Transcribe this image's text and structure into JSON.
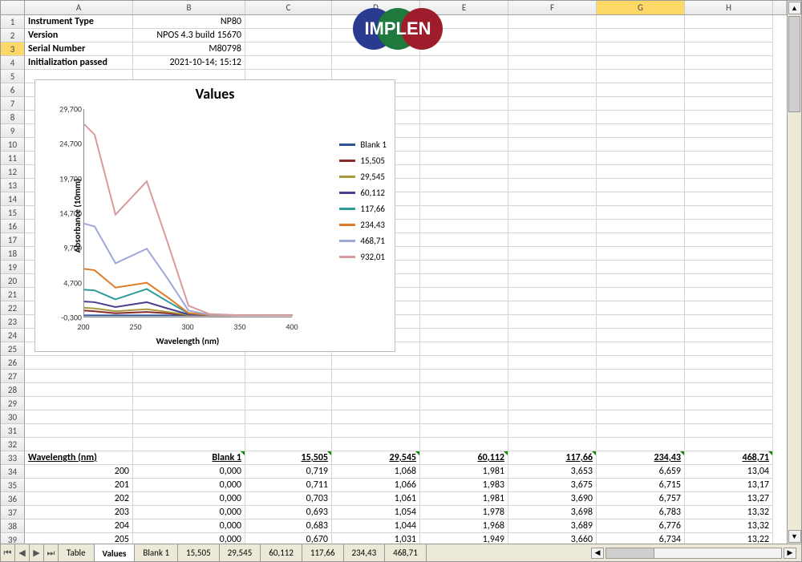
{
  "columns": [
    "A",
    "B",
    "C",
    "D",
    "E",
    "F",
    "G",
    "H"
  ],
  "active_column": "G",
  "row_start": 1,
  "row_end": 39,
  "active_row": 3,
  "info_rows": [
    {
      "label": "Instrument Type",
      "value": "NP80"
    },
    {
      "label": "Version",
      "value": "NPOS 4.3 build 15670"
    },
    {
      "label": "Serial Number",
      "value": "M80798"
    },
    {
      "label": "Initialization passed",
      "value": "2021-10-14;  15:12"
    }
  ],
  "logo_text": "IMPLEN",
  "table_header_row": 33,
  "table_headers": [
    "Wavelength (nm)",
    "Blank 1",
    "15,505",
    "29,545",
    "60,112",
    "117,66",
    "234,43",
    "468,71"
  ],
  "data_rows": [
    {
      "r": 34,
      "wl": "200",
      "v": [
        "0,000",
        "0,719",
        "1,068",
        "1,981",
        "3,653",
        "6,659",
        "13,04"
      ]
    },
    {
      "r": 35,
      "wl": "201",
      "v": [
        "0,000",
        "0,711",
        "1,066",
        "1,983",
        "3,675",
        "6,715",
        "13,17"
      ]
    },
    {
      "r": 36,
      "wl": "202",
      "v": [
        "0,000",
        "0,703",
        "1,061",
        "1,981",
        "3,690",
        "6,757",
        "13,27"
      ]
    },
    {
      "r": 37,
      "wl": "203",
      "v": [
        "0,000",
        "0,693",
        "1,054",
        "1,978",
        "3,698",
        "6,783",
        "13,32"
      ]
    },
    {
      "r": 38,
      "wl": "204",
      "v": [
        "0,000",
        "0,683",
        "1,044",
        "1,968",
        "3,689",
        "6,776",
        "13,32"
      ]
    },
    {
      "r": 39,
      "wl": "205",
      "v": [
        "0,000",
        "0,670",
        "1,031",
        "1,949",
        "3,660",
        "6,734",
        "13,22"
      ]
    }
  ],
  "tabs": [
    "Table",
    "Values",
    "Blank 1",
    "15,505",
    "29,545",
    "60,112",
    "117,66",
    "234,43",
    "468,71"
  ],
  "active_tab": "Values",
  "chart_data": {
    "type": "line",
    "title": "Values",
    "xlabel": "Wavelength (nm)",
    "ylabel": "Absorbance (10mm)",
    "xlim": [
      200,
      400
    ],
    "ylim": [
      -0.3,
      29.7
    ],
    "xticks": [
      200,
      250,
      300,
      350,
      400
    ],
    "yticks_labels": [
      "-0,300",
      "4,700",
      "9,700",
      "14,700",
      "19,700",
      "24,700",
      "29,700"
    ],
    "series": [
      {
        "name": "Blank 1",
        "color": "#2f5597",
        "x": [
          200,
          220,
          240,
          260,
          280,
          300,
          320,
          350,
          400
        ],
        "y": [
          0,
          0,
          0,
          0,
          0,
          0,
          0,
          0,
          0
        ]
      },
      {
        "name": "15,505",
        "color": "#8b2a2a",
        "x": [
          200,
          210,
          230,
          260,
          280,
          300,
          320,
          350,
          400
        ],
        "y": [
          0.7,
          0.6,
          0.3,
          0.5,
          0.3,
          0.05,
          0,
          0,
          0
        ]
      },
      {
        "name": "29,545",
        "color": "#a89a3d",
        "x": [
          200,
          210,
          230,
          260,
          280,
          300,
          320,
          350,
          400
        ],
        "y": [
          1.1,
          1.0,
          0.6,
          0.9,
          0.5,
          0.08,
          0,
          0,
          0
        ]
      },
      {
        "name": "60,112",
        "color": "#4b3e8f",
        "x": [
          200,
          210,
          230,
          260,
          280,
          300,
          320,
          350,
          400
        ],
        "y": [
          2.0,
          1.9,
          1.2,
          1.9,
          1.0,
          0.15,
          0.02,
          0,
          0
        ]
      },
      {
        "name": "117,66",
        "color": "#2e9c99",
        "x": [
          200,
          210,
          230,
          260,
          280,
          300,
          320,
          350,
          400
        ],
        "y": [
          3.7,
          3.6,
          2.3,
          3.8,
          2.0,
          0.3,
          0.05,
          0,
          0
        ]
      },
      {
        "name": "234,43",
        "color": "#e07b27",
        "x": [
          200,
          210,
          230,
          260,
          280,
          300,
          320,
          350,
          400
        ],
        "y": [
          6.7,
          6.5,
          4.0,
          4.7,
          2.6,
          0.35,
          0.05,
          0,
          0
        ]
      },
      {
        "name": "468,71",
        "color": "#9fa7d6",
        "x": [
          200,
          210,
          230,
          260,
          280,
          300,
          320,
          350,
          400
        ],
        "y": [
          13.2,
          12.8,
          7.5,
          9.6,
          5.3,
          0.7,
          0.1,
          0,
          0
        ]
      },
      {
        "name": "932,01",
        "color": "#d89a9a",
        "x": [
          200,
          210,
          230,
          260,
          280,
          300,
          320,
          350,
          400
        ],
        "y": [
          27.5,
          26.0,
          14.5,
          19.3,
          10.5,
          1.4,
          0.2,
          0.02,
          0
        ]
      }
    ]
  }
}
